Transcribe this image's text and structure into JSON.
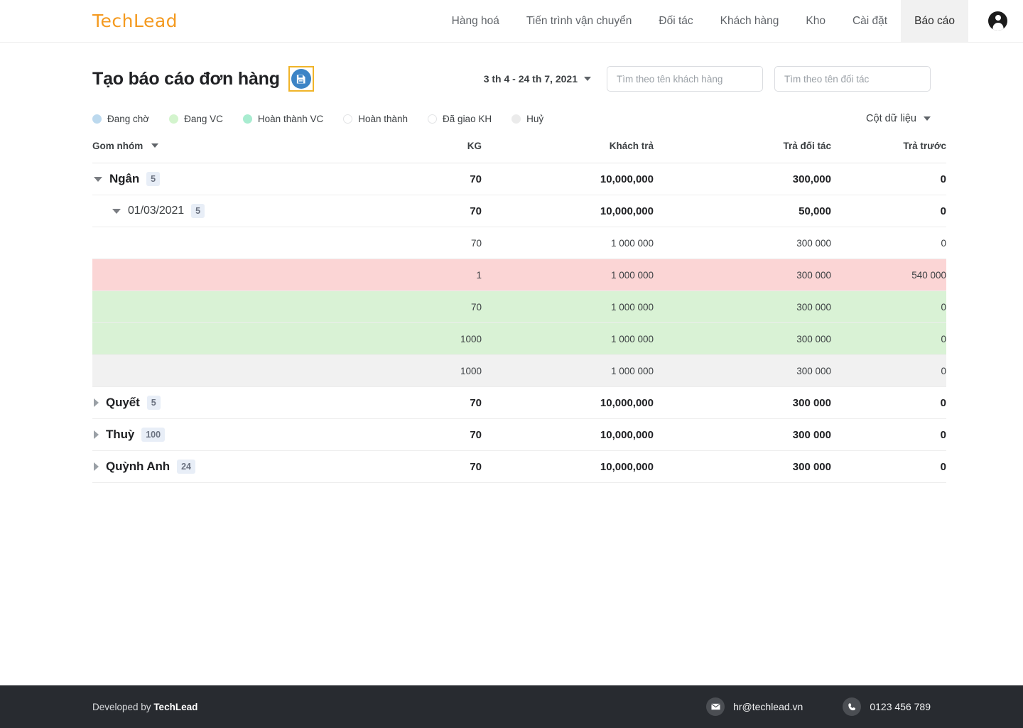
{
  "brand": {
    "logo_text": "TechLead",
    "logo_color": "#f49a20"
  },
  "nav": {
    "items": [
      {
        "label": "Hàng hoá",
        "active": false
      },
      {
        "label": "Tiến trình vận chuyển",
        "active": false
      },
      {
        "label": "Đối tác",
        "active": false
      },
      {
        "label": "Khách hàng",
        "active": false
      },
      {
        "label": "Kho",
        "active": false
      },
      {
        "label": "Cài đặt",
        "active": false
      },
      {
        "label": "Báo cáo",
        "active": true
      }
    ],
    "avatar_icon": "user-avatar-icon"
  },
  "header": {
    "title": "Tạo báo cáo đơn hàng",
    "save_icon": "floppy-disk-save-icon",
    "save_accent": "#3d84c6",
    "focus_outline": "#f0b429",
    "date_range": "3 th 4  -  24 th 7, 2021",
    "customer_search_placeholder": "Tìm theo tên khách hàng",
    "customer_search_value": "",
    "partner_search_placeholder": "Tìm theo tên đối tác",
    "partner_search_value": ""
  },
  "legend": {
    "items": [
      {
        "label": "Đang chờ",
        "color": "#bcd9ee",
        "border": "#bcd9ee"
      },
      {
        "label": "Đang VC",
        "color": "#d3f4cd",
        "border": "#d3f4cd"
      },
      {
        "label": "Hoàn thành VC",
        "color": "#a8ecd0",
        "border": "#a8ecd0"
      },
      {
        "label": "Hoàn thành",
        "color": "#ffffff",
        "border": "#e2e3e5"
      },
      {
        "label": "Đã giao KH",
        "color": "#ffffff",
        "border": "#e2e3e5"
      },
      {
        "label": "Huỷ",
        "color": "#ebebeb",
        "border": "#ebebeb"
      }
    ],
    "columns_button": "Cột dữ liệu"
  },
  "table": {
    "headers": {
      "group": "Gom nhóm",
      "kg": "KG",
      "khach_tra": "Khách trả",
      "tra_doi_tac": "Trả đối tác",
      "tra_truoc": "Trả trước"
    },
    "rows": [
      {
        "kind": "group",
        "level": 1,
        "expanded": true,
        "label": "Ngân",
        "count": "5",
        "kg": "70",
        "khach_tra": "10,000,000",
        "tra_doi_tac": "300,000",
        "tra_truoc": "0",
        "bg": "white"
      },
      {
        "kind": "group",
        "level": 2,
        "expanded": true,
        "label": "01/03/2021",
        "count": "5",
        "kg": "70",
        "khach_tra": "10,000,000",
        "tra_doi_tac": "50,000",
        "tra_truoc": "0",
        "bg": "white"
      },
      {
        "kind": "data",
        "level": 3,
        "label": "",
        "kg": "70",
        "khach_tra": "1 000 000",
        "tra_doi_tac": "300 000",
        "tra_truoc": "0",
        "bg": "white"
      },
      {
        "kind": "data",
        "level": 3,
        "label": "",
        "kg": "1",
        "khach_tra": "1 000 000",
        "tra_doi_tac": "300 000",
        "tra_truoc": "540 000",
        "bg": "pink"
      },
      {
        "kind": "data",
        "level": 3,
        "label": "",
        "kg": "70",
        "khach_tra": "1 000 000",
        "tra_doi_tac": "300 000",
        "tra_truoc": "0",
        "bg": "green"
      },
      {
        "kind": "data",
        "level": 3,
        "label": "",
        "kg": "1000",
        "khach_tra": "1 000 000",
        "tra_doi_tac": "300 000",
        "tra_truoc": "0",
        "bg": "green"
      },
      {
        "kind": "data",
        "level": 3,
        "label": "",
        "kg": "1000",
        "khach_tra": "1 000 000",
        "tra_doi_tac": "300 000",
        "tra_truoc": "0",
        "bg": "grey"
      },
      {
        "kind": "group",
        "level": 1,
        "expanded": false,
        "label": "Quyết",
        "count": "5",
        "kg": "70",
        "khach_tra": "10,000,000",
        "tra_doi_tac": "300 000",
        "tra_truoc": "0",
        "bg": "white"
      },
      {
        "kind": "group",
        "level": 1,
        "expanded": false,
        "label": "Thuỳ",
        "count": "100",
        "kg": "70",
        "khach_tra": "10,000,000",
        "tra_doi_tac": "300 000",
        "tra_truoc": "0",
        "bg": "white"
      },
      {
        "kind": "group",
        "level": 1,
        "expanded": false,
        "label": "Quỳnh Anh",
        "count": "24",
        "kg": "70",
        "khach_tra": "10,000,000",
        "tra_doi_tac": "300 000",
        "tra_truoc": "0",
        "bg": "white"
      }
    ]
  },
  "footer": {
    "developed_by_prefix": "Developed by ",
    "developed_by_brand": "TechLead",
    "email": "hr@techlead.vn",
    "email_icon": "mail-icon",
    "phone": "0123 456 789",
    "phone_icon": "phone-icon",
    "background": "#282b30"
  }
}
